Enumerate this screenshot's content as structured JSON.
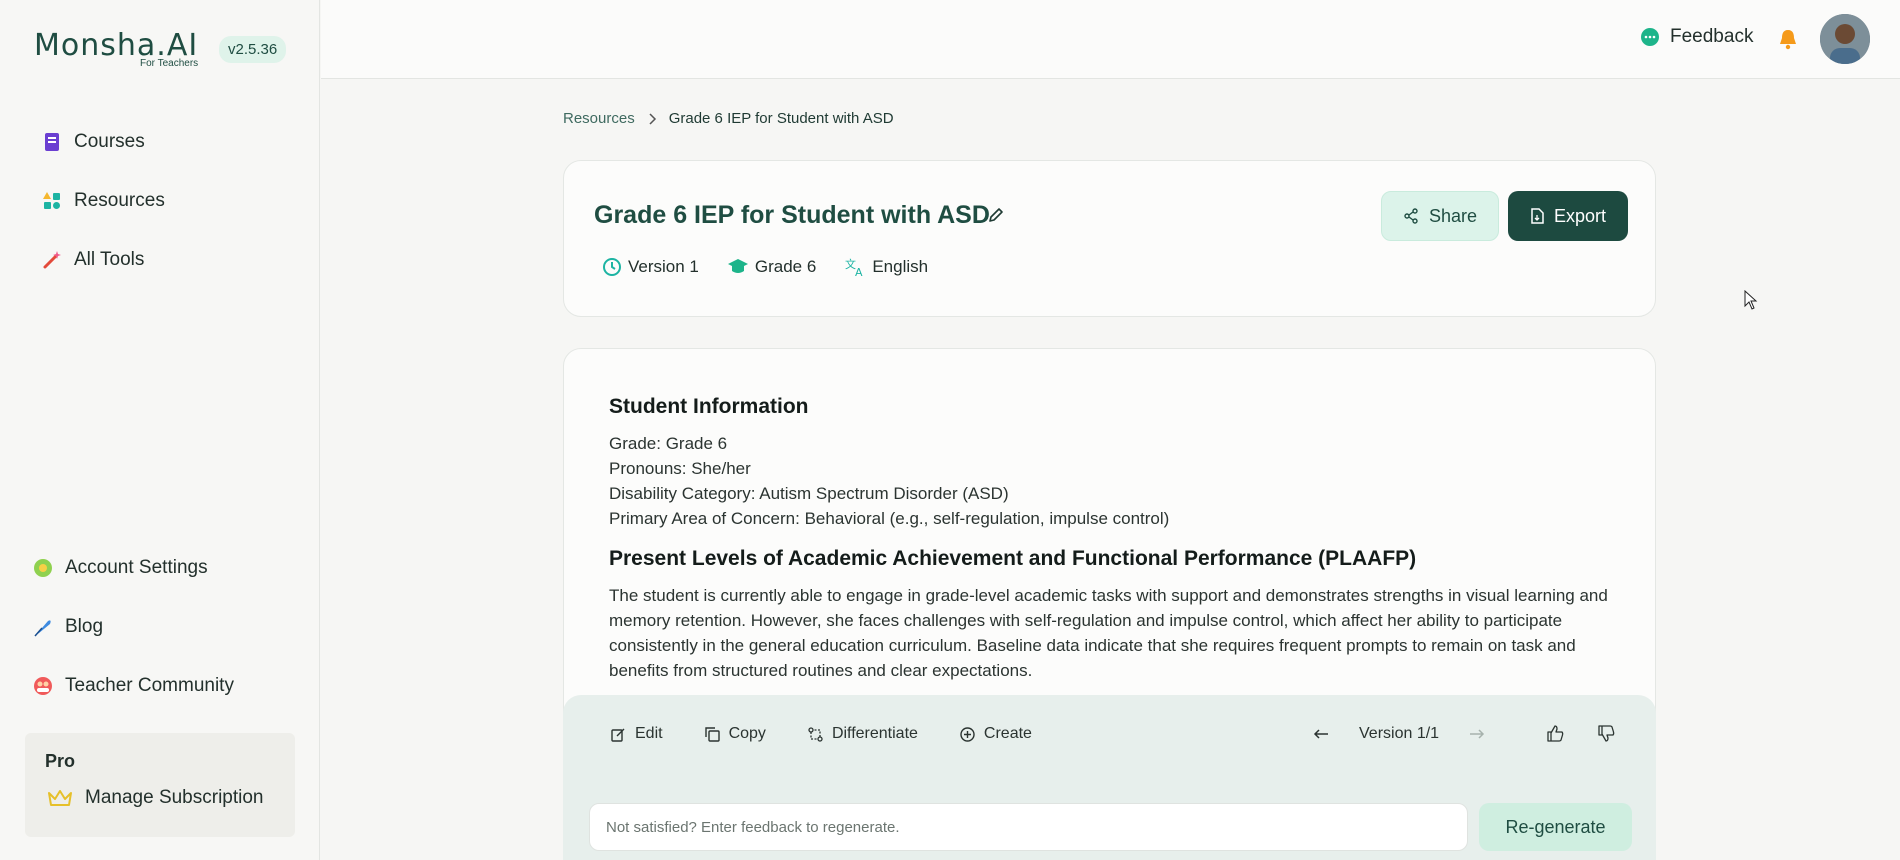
{
  "brand": {
    "name": "Monsha.AI",
    "sub": "For Teachers",
    "version": "v2.5.36"
  },
  "sidebar": {
    "items": [
      {
        "label": "Courses",
        "icon": "book-icon"
      },
      {
        "label": "Resources",
        "icon": "shapes-icon"
      },
      {
        "label": "All Tools",
        "icon": "magic-wand-icon"
      }
    ],
    "bottom_items": [
      {
        "label": "Account Settings",
        "icon": "gear-icon"
      },
      {
        "label": "Blog",
        "icon": "feather-icon"
      },
      {
        "label": "Teacher Community",
        "icon": "community-icon"
      }
    ],
    "pro": {
      "label": "Pro",
      "manage": "Manage Subscription"
    }
  },
  "topbar": {
    "feedback": "Feedback"
  },
  "breadcrumb": {
    "root": "Resources",
    "current": "Grade 6 IEP for Student with ASD"
  },
  "doc": {
    "title": "Grade 6 IEP for Student with ASD",
    "version": "Version 1",
    "grade": "Grade 6",
    "language": "English",
    "share": "Share",
    "export": "Export"
  },
  "content": {
    "section1_title": "Student Information",
    "lines": [
      "Grade: Grade 6",
      "Pronouns: She/her",
      "Disability Category: Autism Spectrum Disorder (ASD)",
      "Primary Area of Concern: Behavioral (e.g., self-regulation, impulse control)"
    ],
    "section2_title": "Present Levels of Academic Achievement and Functional Performance (PLAAFP)",
    "section2_body": "The student is currently able to engage in grade-level academic tasks with support and demonstrates strengths in visual learning and memory retention. However, she faces challenges with self-regulation and impulse control, which affect her ability to participate consistently in the general education curriculum. Baseline data indicate that she requires frequent prompts to remain on task and benefits from structured routines and clear expectations."
  },
  "actions": {
    "edit": "Edit",
    "copy": "Copy",
    "differentiate": "Differentiate",
    "create": "Create",
    "version_label": "Version 1/1",
    "feedback_placeholder": "Not satisfied? Enter feedback to regenerate.",
    "regenerate": "Re-generate"
  }
}
